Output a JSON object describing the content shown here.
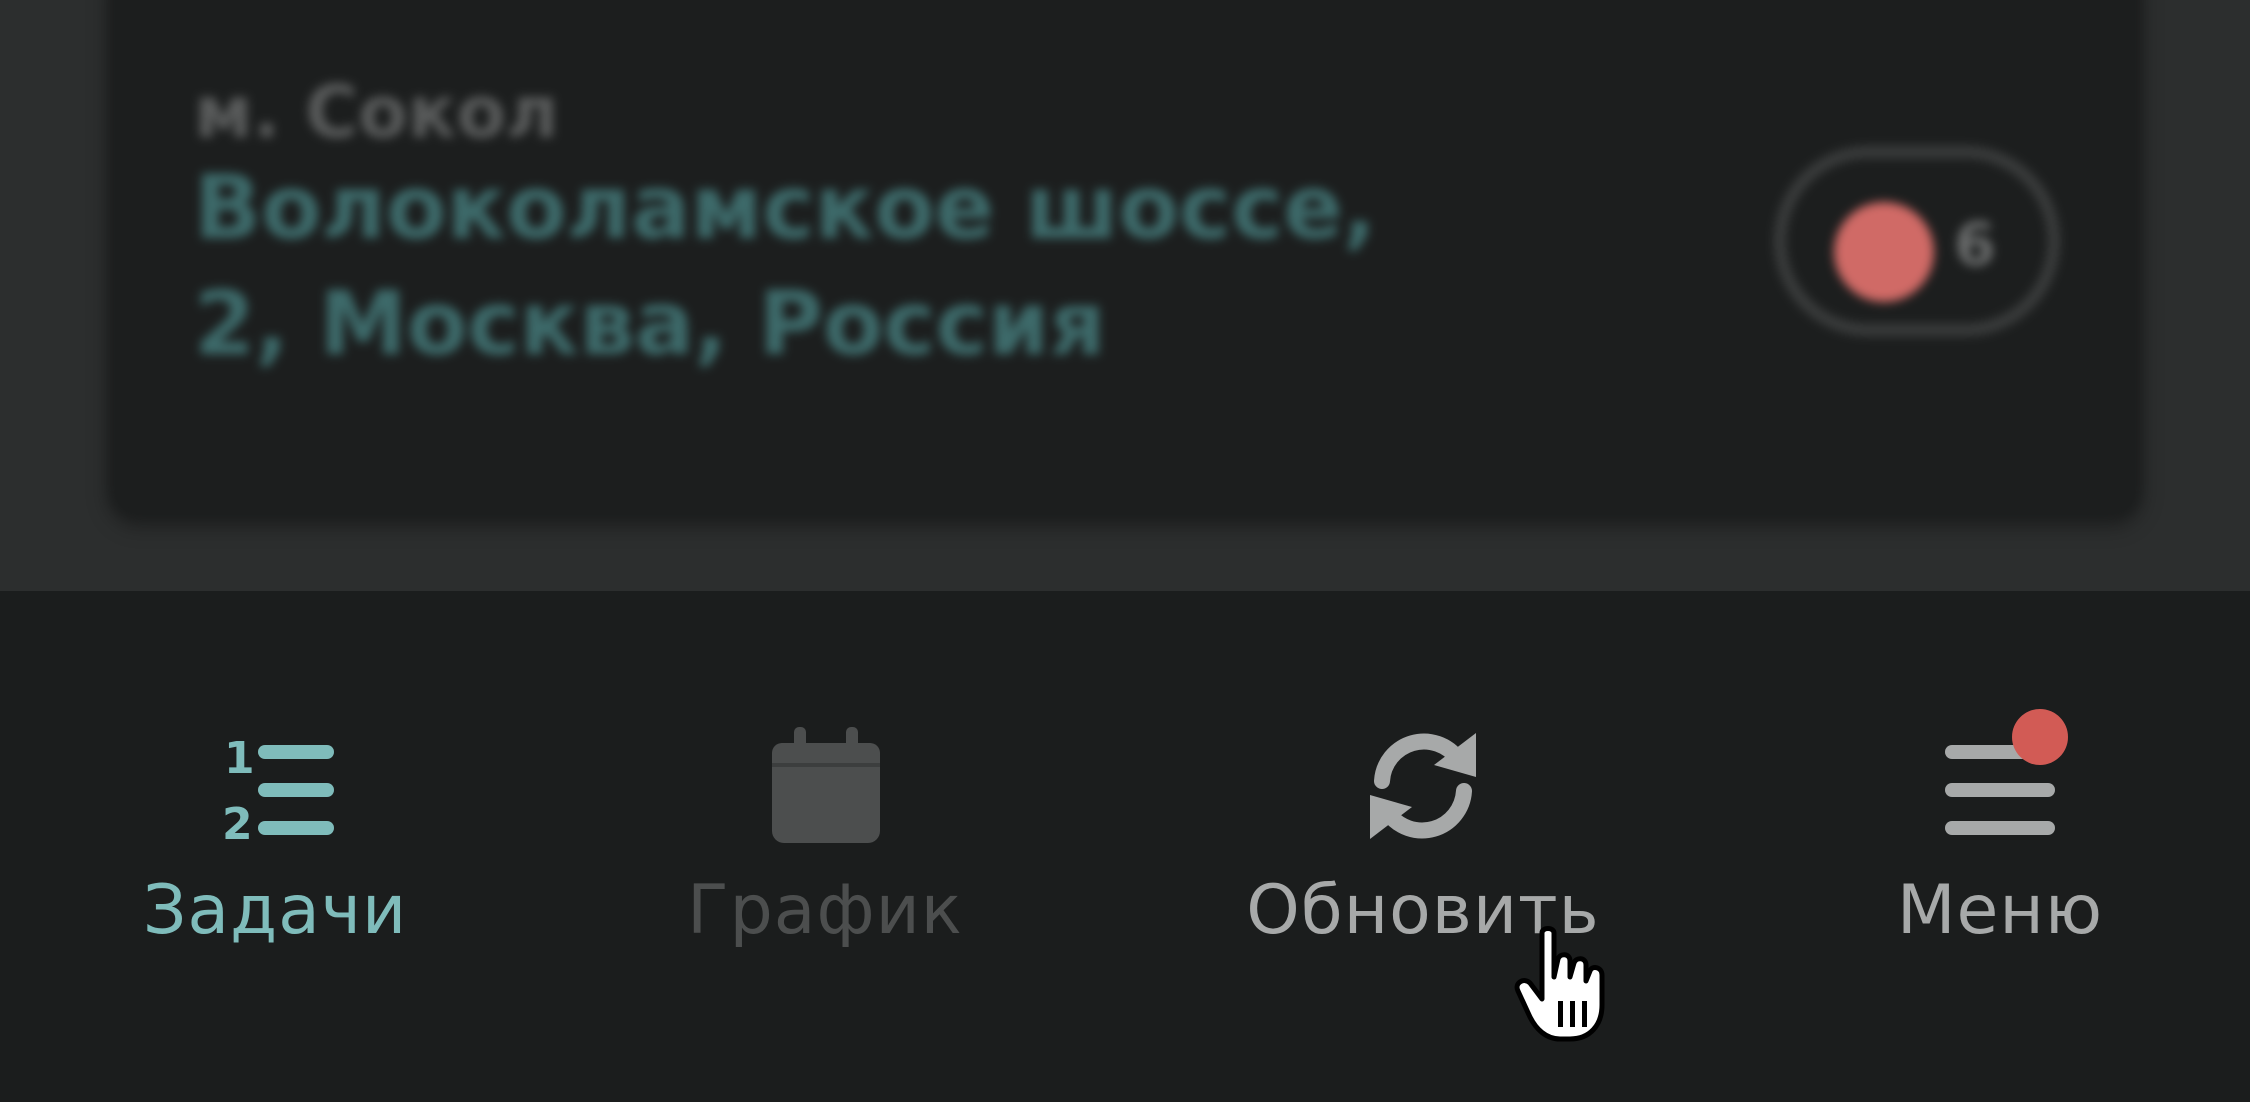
{
  "card": {
    "metro_station": "м. Сокол",
    "address": "Волоколамское шоссе, 2, Москва, Россия",
    "toggle_count": "6"
  },
  "nav": {
    "items": [
      {
        "label": "Задачи",
        "icon": "numbered-list-icon",
        "state": "active"
      },
      {
        "label": "График",
        "icon": "calendar-icon",
        "state": "disabled"
      },
      {
        "label": "Обновить",
        "icon": "refresh-icon",
        "state": "normal"
      },
      {
        "label": "Меню",
        "icon": "hamburger-menu-icon",
        "state": "normal",
        "has_badge": true
      }
    ]
  },
  "colors": {
    "accent": "#7fbcbb",
    "badge": "#d25b55",
    "inactive": "#4c4e4e",
    "text_secondary": "#a7a9a9",
    "background": "#1b1d1d"
  }
}
